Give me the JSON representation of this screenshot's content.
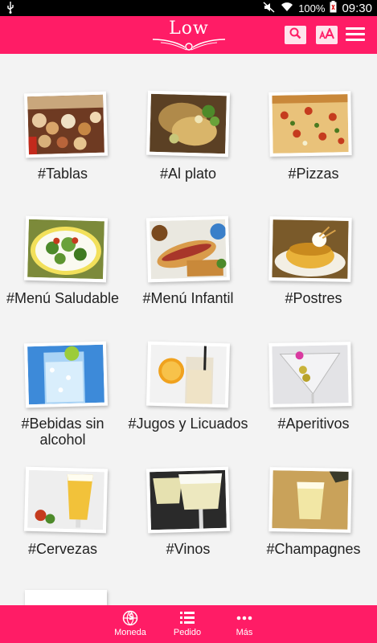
{
  "statusbar": {
    "battery_percent": "100%",
    "time": "09:30"
  },
  "header": {
    "logo_text": "Low"
  },
  "categories": [
    {
      "label": "#Tablas"
    },
    {
      "label": "#Al plato"
    },
    {
      "label": "#Pizzas"
    },
    {
      "label": "#Menú Saludable"
    },
    {
      "label": "#Menú Infantil"
    },
    {
      "label": "#Postres"
    },
    {
      "label": "#Bebidas sin alcohol"
    },
    {
      "label": "#Jugos y Licuados"
    },
    {
      "label": "#Aperitivos"
    },
    {
      "label": "#Cervezas"
    },
    {
      "label": "#Vinos"
    },
    {
      "label": "#Champagnes"
    }
  ],
  "bottom_nav": [
    {
      "label": "Moneda",
      "icon": "currency-globe-icon"
    },
    {
      "label": "Pedido",
      "icon": "list-icon"
    },
    {
      "label": "Más",
      "icon": "more-dots-icon"
    }
  ],
  "colors": {
    "brand": "#ff1c66",
    "background": "#f3f3f3"
  }
}
